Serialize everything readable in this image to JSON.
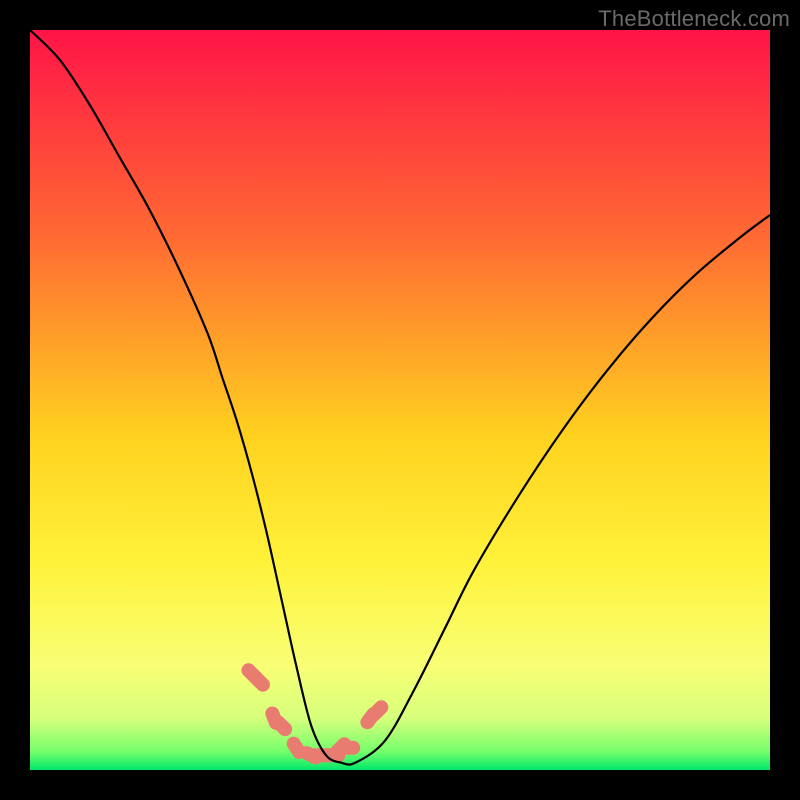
{
  "watermark": {
    "text": "TheBottleneck.com"
  },
  "chart_data": {
    "type": "line",
    "title": "",
    "xlabel": "",
    "ylabel": "",
    "xlim": [
      0,
      100
    ],
    "ylim": [
      0,
      100
    ],
    "grid": false,
    "legend": false,
    "gradient_stops": [
      {
        "offset": 0,
        "color": "#ff1447"
      },
      {
        "offset": 0.28,
        "color": "#ff6a33"
      },
      {
        "offset": 0.55,
        "color": "#ffd21f"
      },
      {
        "offset": 0.72,
        "color": "#fff23a"
      },
      {
        "offset": 0.86,
        "color": "#f8ff75"
      },
      {
        "offset": 0.93,
        "color": "#d7ff7c"
      },
      {
        "offset": 0.975,
        "color": "#76ff6b"
      },
      {
        "offset": 1.0,
        "color": "#00e86b"
      }
    ],
    "series": [
      {
        "name": "bottleneck-curve",
        "x": [
          0,
          4,
          8,
          12,
          16,
          20,
          24,
          26,
          28,
          30,
          32,
          34,
          36,
          38,
          40,
          42,
          44,
          48,
          52,
          56,
          60,
          66,
          72,
          78,
          84,
          90,
          96,
          100
        ],
        "values": [
          100,
          96,
          90,
          83,
          76,
          68,
          59,
          53,
          47,
          40,
          32,
          23,
          14,
          6,
          2,
          1,
          1,
          4,
          11,
          19,
          27,
          37,
          46,
          54,
          61,
          67,
          72,
          75
        ]
      },
      {
        "name": "highlight-dots",
        "x": [
          30,
          31,
          33,
          34,
          36,
          38,
          39,
          40,
          41,
          42,
          43,
          46,
          47
        ],
        "values": [
          13,
          12,
          7,
          6,
          3,
          2,
          2,
          2,
          2,
          3,
          3,
          7,
          8
        ]
      }
    ],
    "colors": {
      "curve": "#000000",
      "dots": "#e97c71"
    }
  }
}
